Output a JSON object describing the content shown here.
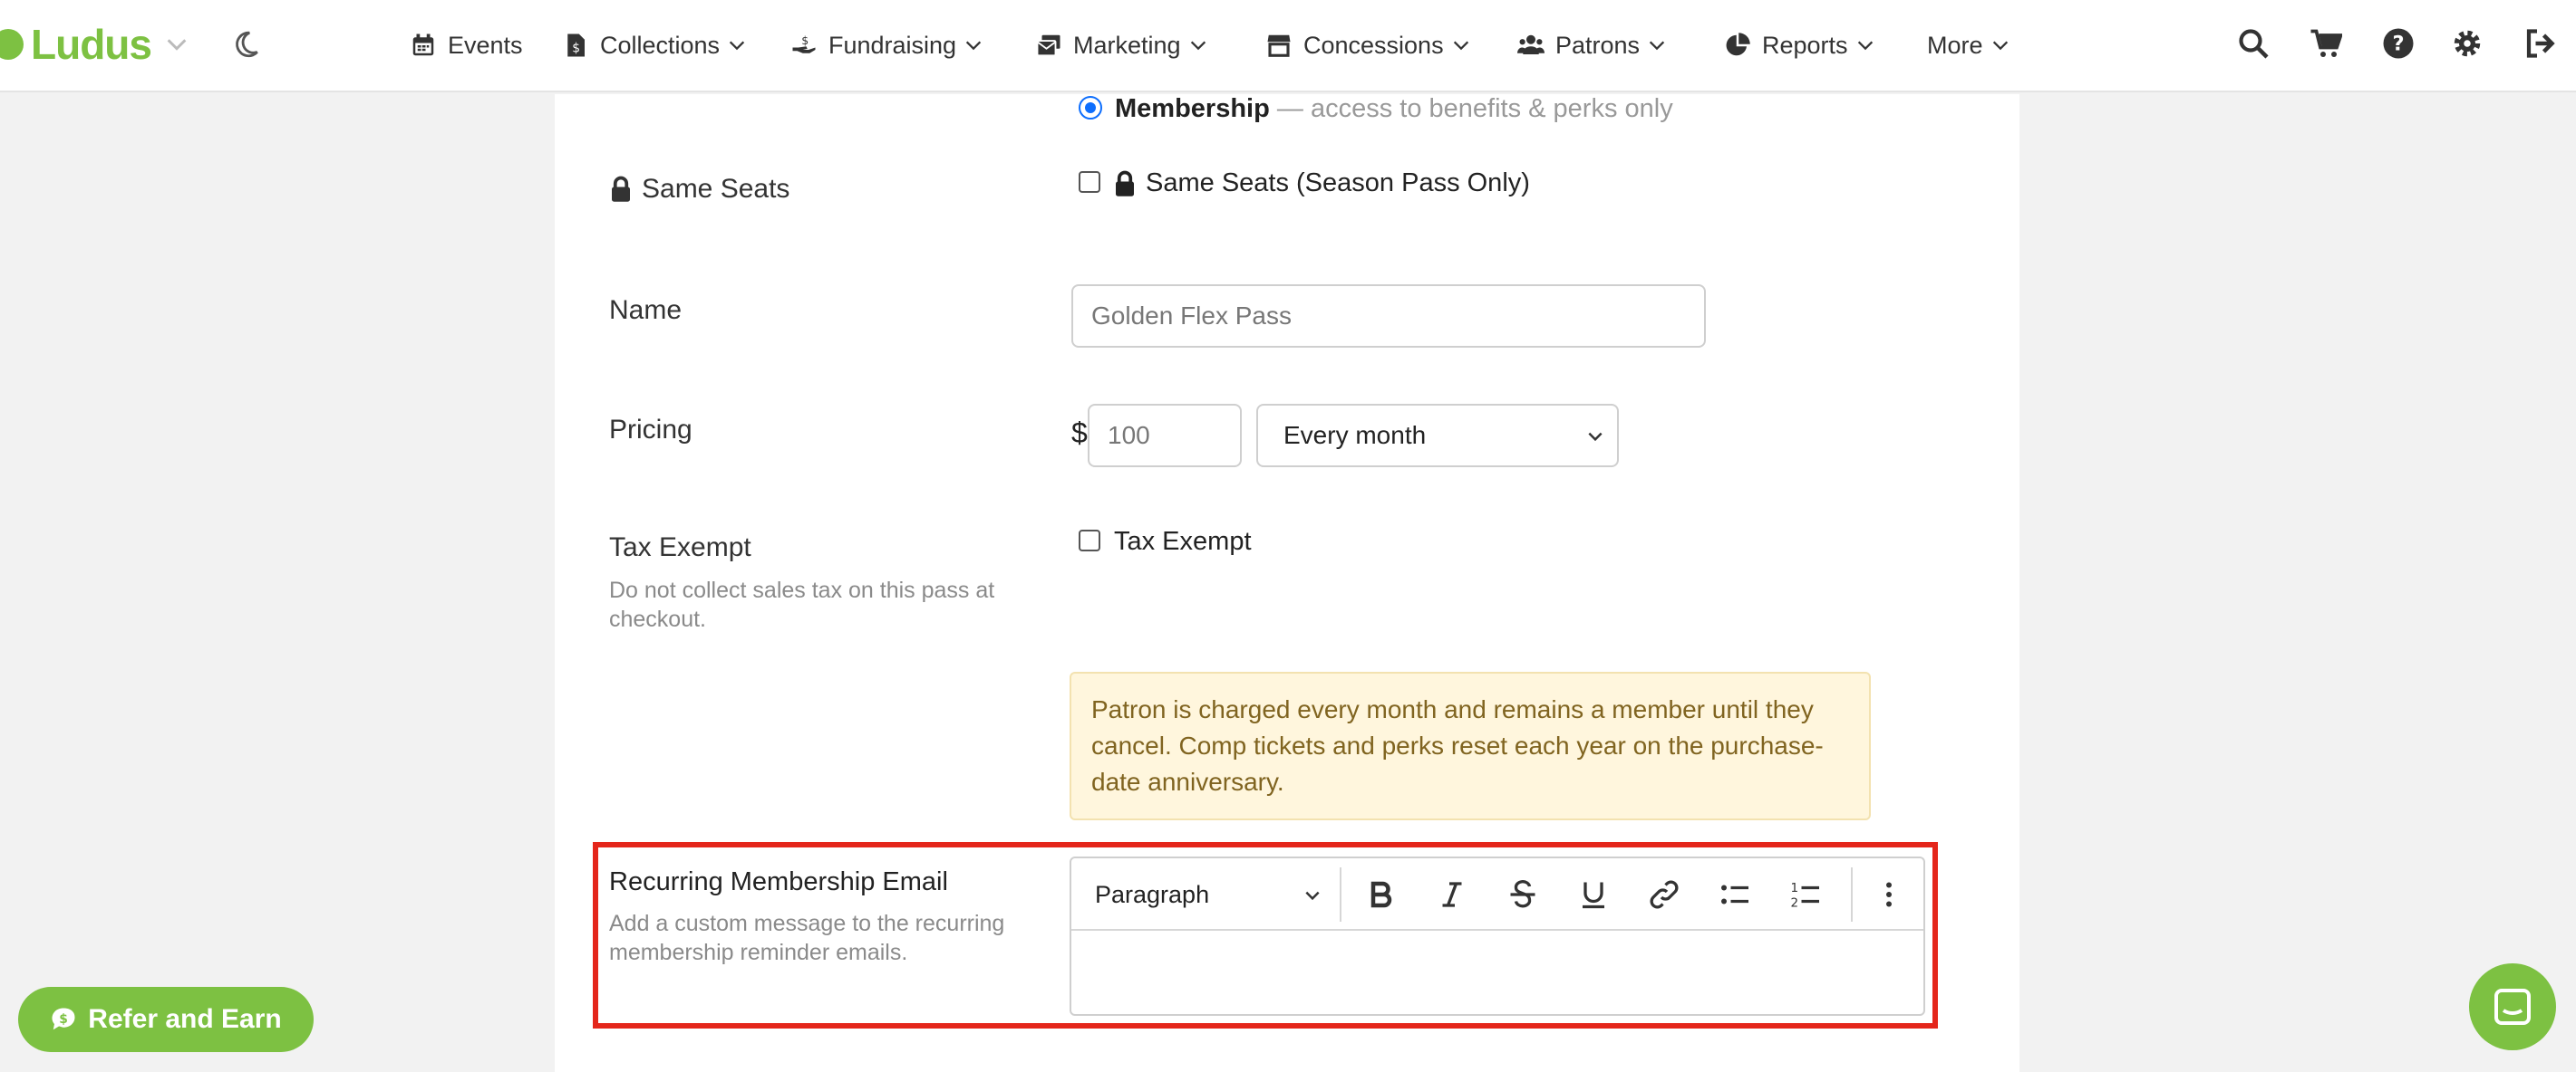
{
  "navbar": {
    "logo_text": "Ludus",
    "items": [
      {
        "label": "Events",
        "icon": "calendar-icon"
      },
      {
        "label": "Collections",
        "icon": "file-dollar-icon"
      },
      {
        "label": "Fundraising",
        "icon": "hand-dollar-icon"
      },
      {
        "label": "Marketing",
        "icon": "envelopes-icon"
      },
      {
        "label": "Concessions",
        "icon": "store-icon"
      },
      {
        "label": "Patrons",
        "icon": "users-icon"
      },
      {
        "label": "Reports",
        "icon": "pie-chart-icon"
      },
      {
        "label": "More",
        "icon": ""
      }
    ],
    "right_icons": [
      "search-icon",
      "cart-icon",
      "help-icon",
      "gear-icon",
      "sign-out-icon"
    ]
  },
  "form": {
    "membership_option": {
      "label": "Membership",
      "description": "— access to benefits & perks only"
    },
    "same_seats": {
      "label": "Same Seats",
      "checkbox_label": "Same Seats (Season Pass Only)"
    },
    "name": {
      "label": "Name",
      "value": "Golden Flex Pass"
    },
    "pricing": {
      "label": "Pricing",
      "currency": "$",
      "amount": "100",
      "frequency": "Every month"
    },
    "tax_exempt": {
      "label": "Tax Exempt",
      "help": "Do not collect sales tax on this pass at checkout.",
      "checkbox_label": "Tax Exempt"
    },
    "notice": "Patron is charged every month and remains a member until they cancel. Comp tickets and perks reset each year on the purchase-date anniversary.",
    "recurring_email": {
      "label": "Recurring Membership Email",
      "help": "Add a custom message to the recurring membership reminder emails.",
      "editor_format": "Paragraph"
    }
  },
  "refer_button": "Refer and Earn",
  "colors": {
    "brand": "#7dc142",
    "highlight": "#e4261b",
    "radio": "#0d6efd",
    "alert_bg": "#fff6dd",
    "alert_text": "#806420"
  }
}
